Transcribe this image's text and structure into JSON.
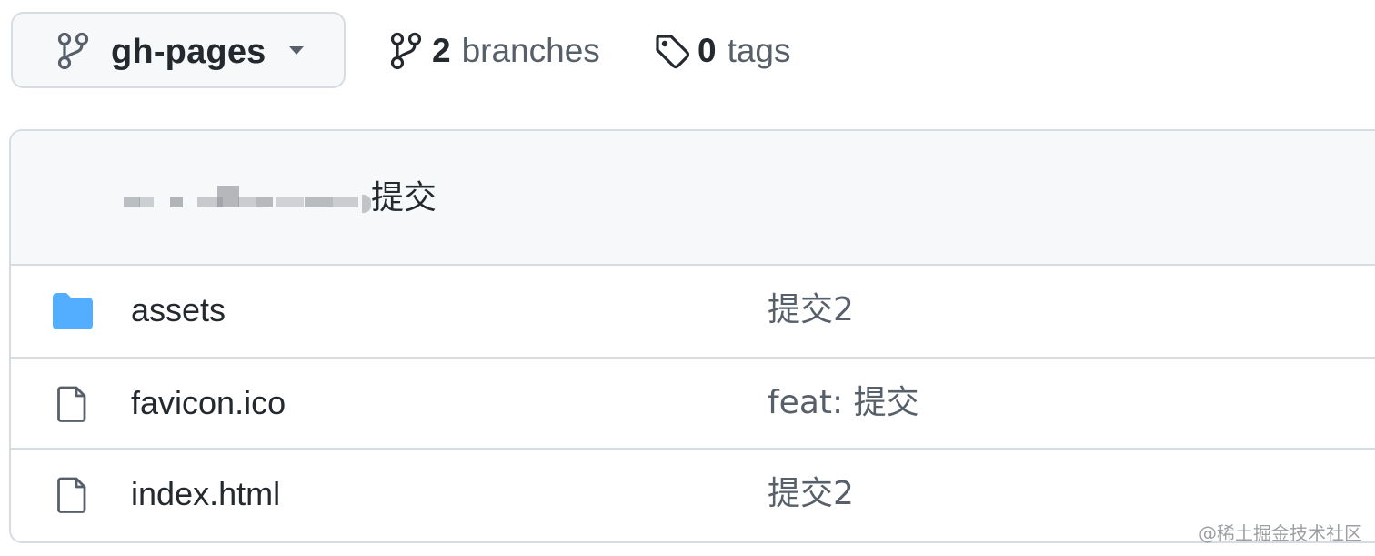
{
  "toolbar": {
    "branch": {
      "name": "gh-pages",
      "icon": "git-branch-icon",
      "dropdown_icon": "caret-down-icon"
    },
    "branches": {
      "count": "2",
      "label": "branches",
      "icon": "git-branch-icon"
    },
    "tags": {
      "count": "0",
      "label": "tags",
      "icon": "tag-icon"
    }
  },
  "latest_commit": {
    "author": "",
    "message": "提交"
  },
  "files": [
    {
      "name": "assets",
      "type": "directory",
      "icon": "folder-icon",
      "commit_message": "提交2"
    },
    {
      "name": "favicon.ico",
      "type": "file",
      "icon": "file-icon",
      "commit_message": "feat: 提交"
    },
    {
      "name": "index.html",
      "type": "file",
      "icon": "file-icon",
      "commit_message": "提交2"
    }
  ],
  "watermark": "@稀土掘金技术社区",
  "colors": {
    "text_primary": "#24292f",
    "text_muted": "#57606a",
    "border": "#d7dce2",
    "subtle_background": "#f6f8fa",
    "folder_blue": "#54aeff"
  }
}
